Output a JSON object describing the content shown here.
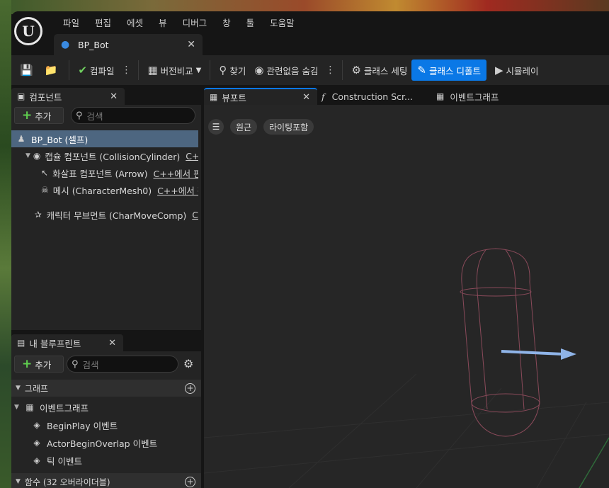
{
  "app": {
    "menu": [
      "파일",
      "편집",
      "에셋",
      "뷰",
      "디버그",
      "창",
      "툴",
      "도움말"
    ],
    "document_tab": "BP_Bot"
  },
  "toolbar": {
    "compile": "컴파일",
    "diff": "버전비교",
    "find": "찾기",
    "hide_unrelated": "관련없음 숨김",
    "class_settings": "클래스 세팅",
    "class_defaults": "클래스 디폴트",
    "simulate": "시뮬레이"
  },
  "components_panel": {
    "tab": "컴포넌트",
    "add": "추가",
    "search_placeholder": "검색",
    "tree": [
      {
        "label": "BP_Bot (셀프)",
        "cpp": ""
      },
      {
        "label": "캡슐 컴포넌트 (CollisionCylinder)",
        "cpp": "C++"
      },
      {
        "label": "화살표 컴포넌트 (Arrow)",
        "cpp": "C++에서 편"
      },
      {
        "label": "메시 (CharacterMesh0)",
        "cpp": "C++에서 편"
      },
      {
        "label": "캐릭터 무브먼트 (CharMoveComp)",
        "cpp": "C"
      }
    ]
  },
  "blueprint_panel": {
    "tab": "내 블루프린트",
    "add": "추가",
    "search_placeholder": "검색",
    "graphs_header": "그래프",
    "event_graph": "이벤트그래프",
    "events": [
      "BeginPlay 이벤트",
      "ActorBeginOverlap 이벤트",
      "틱 이벤트"
    ],
    "functions_header": "함수 (32 오버라이더블)"
  },
  "editor_tabs": {
    "viewport": "뷰포트",
    "construction": "Construction Scr...",
    "event_graph": "이벤트그래프"
  },
  "viewport": {
    "perspective": "원근",
    "lighting": "라이팅포함"
  }
}
